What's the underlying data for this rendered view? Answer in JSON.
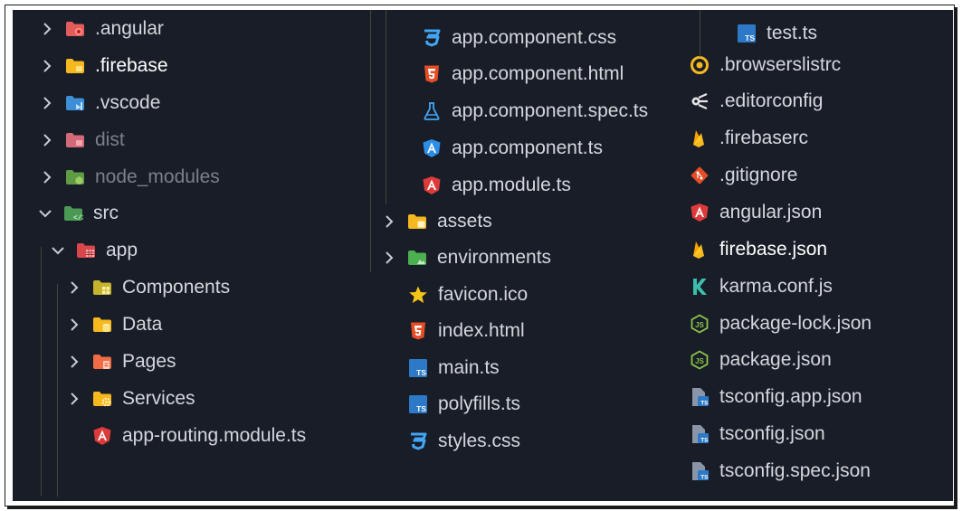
{
  "explorer": {
    "column1": [
      {
        "label": ".angular",
        "icon": "folder-angular-icon",
        "chevron": "right"
      },
      {
        "label": ".firebase",
        "icon": "folder-firebase-icon",
        "chevron": "right"
      },
      {
        "label": ".vscode",
        "icon": "folder-vscode-icon",
        "chevron": "right"
      },
      {
        "label": "dist",
        "icon": "folder-dist-icon",
        "chevron": "right"
      },
      {
        "label": "node_modules",
        "icon": "folder-node-icon",
        "chevron": "right"
      },
      {
        "label": "src",
        "icon": "folder-src-icon",
        "chevron": "down"
      },
      {
        "label": "app",
        "icon": "folder-app-icon",
        "chevron": "down"
      },
      {
        "label": "Components",
        "icon": "folder-components-icon",
        "chevron": "right"
      },
      {
        "label": "Data",
        "icon": "folder-data-icon",
        "chevron": "right"
      },
      {
        "label": "Pages",
        "icon": "folder-pages-icon",
        "chevron": "right"
      },
      {
        "label": "Services",
        "icon": "folder-services-icon",
        "chevron": "right"
      },
      {
        "label": "app-routing.module.ts",
        "icon": "angular-file-icon"
      }
    ],
    "column2": [
      {
        "label": "app.component.css",
        "icon": "css-file-icon"
      },
      {
        "label": "app.component.html",
        "icon": "html-file-icon"
      },
      {
        "label": "app.component.spec.ts",
        "icon": "test-flask-icon"
      },
      {
        "label": "app.component.ts",
        "icon": "angular-component-icon"
      },
      {
        "label": "app.module.ts",
        "icon": "angular-file-icon"
      },
      {
        "label": "assets",
        "icon": "folder-assets-icon",
        "chevron": "right"
      },
      {
        "label": "environments",
        "icon": "folder-environments-icon",
        "chevron": "right"
      },
      {
        "label": "favicon.ico",
        "icon": "star-icon"
      },
      {
        "label": "index.html",
        "icon": "html-file-icon"
      },
      {
        "label": "main.ts",
        "icon": "typescript-file-icon"
      },
      {
        "label": "polyfills.ts",
        "icon": "typescript-file-icon"
      },
      {
        "label": "styles.css",
        "icon": "css-file-icon"
      }
    ],
    "column3": [
      {
        "label": "test.ts",
        "icon": "typescript-file-icon"
      },
      {
        "label": ".browserslistrc",
        "icon": "browserslist-icon"
      },
      {
        "label": ".editorconfig",
        "icon": "editorconfig-icon"
      },
      {
        "label": ".firebaserc",
        "icon": "firebase-icon"
      },
      {
        "label": ".gitignore",
        "icon": "git-icon"
      },
      {
        "label": "angular.json",
        "icon": "angular-file-icon"
      },
      {
        "label": "firebase.json",
        "icon": "firebase-icon"
      },
      {
        "label": "karma.conf.js",
        "icon": "karma-icon"
      },
      {
        "label": "package-lock.json",
        "icon": "nodejs-icon"
      },
      {
        "label": "package.json",
        "icon": "nodejs-icon"
      },
      {
        "label": "tsconfig.app.json",
        "icon": "tsconfig-icon"
      },
      {
        "label": "tsconfig.json",
        "icon": "tsconfig-icon"
      },
      {
        "label": "tsconfig.spec.json",
        "icon": "tsconfig-icon"
      }
    ]
  },
  "colors": {
    "background": "#181d27",
    "text": "#d4d7dc",
    "dim_text": "#7b808a",
    "angular_red": "#dd3b3b",
    "firebase_yellow": "#f5b81e",
    "typescript_blue": "#2d79c7",
    "css_blue": "#42a5f5",
    "html_orange": "#e44d26",
    "node_green": "#8bc34a"
  }
}
